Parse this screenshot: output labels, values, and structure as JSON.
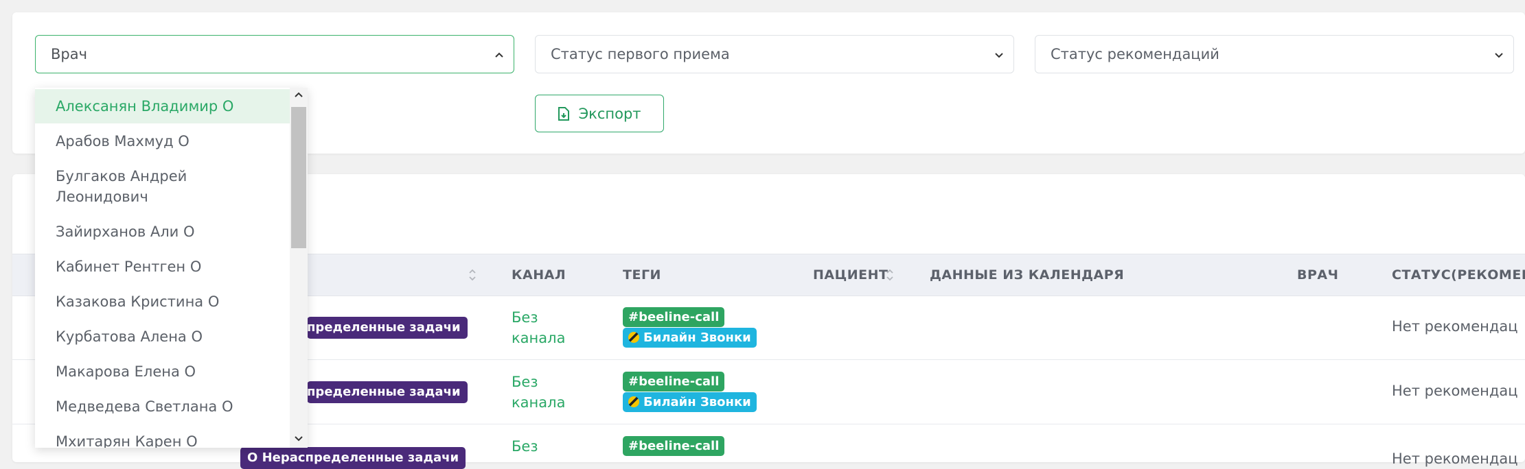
{
  "filters": {
    "doctor_label": "Врач",
    "first_visit_status_label": "Статус первого приема",
    "recommendation_status_label": "Статус рекомендаций",
    "export_label": "Экспорт"
  },
  "doctor_dropdown": {
    "items": [
      "Алексанян Владимир О",
      "Арабов Махмуд О",
      "Булгаков Андрей Леонидович",
      "Зайирханов Али О",
      "Кабинет Рентген О",
      "Казакова Кристина О",
      "Курбатова Алена О",
      "Макарова Елена О",
      "Медведева Светлана О",
      "Мхитарян Карен О"
    ],
    "selected_index": 0
  },
  "table": {
    "columns": {
      "channel": "КАНАЛ",
      "tags": "ТЕГИ",
      "patient": "ПАЦИЕНТ",
      "calendar": "ДАННЫЕ ИЗ КАЛЕНДАРЯ",
      "doctor": "ВРАЧ",
      "status": "СТАТУС(РЕКОМЕН"
    },
    "rows": [
      {
        "badge": "пределенные задачи",
        "channel": "Без канала",
        "tags": [
          "#beeline-call",
          "Билайн Звонки"
        ],
        "status": "Нет рекомендац"
      },
      {
        "badge": "пределенные задачи",
        "channel": "Без канала",
        "tags": [
          "#beeline-call",
          "Билайн Звонки"
        ],
        "status": "Нет рекомендац"
      },
      {
        "badge": "О Нераспределенные задачи",
        "channel": "Без",
        "tags": [
          "#beeline-call"
        ],
        "status": "Нет рекомендац"
      }
    ]
  },
  "colors": {
    "accent_green": "#2aa866",
    "badge_purple": "#4a2a7a",
    "tag_cyan": "#1fb5df"
  }
}
